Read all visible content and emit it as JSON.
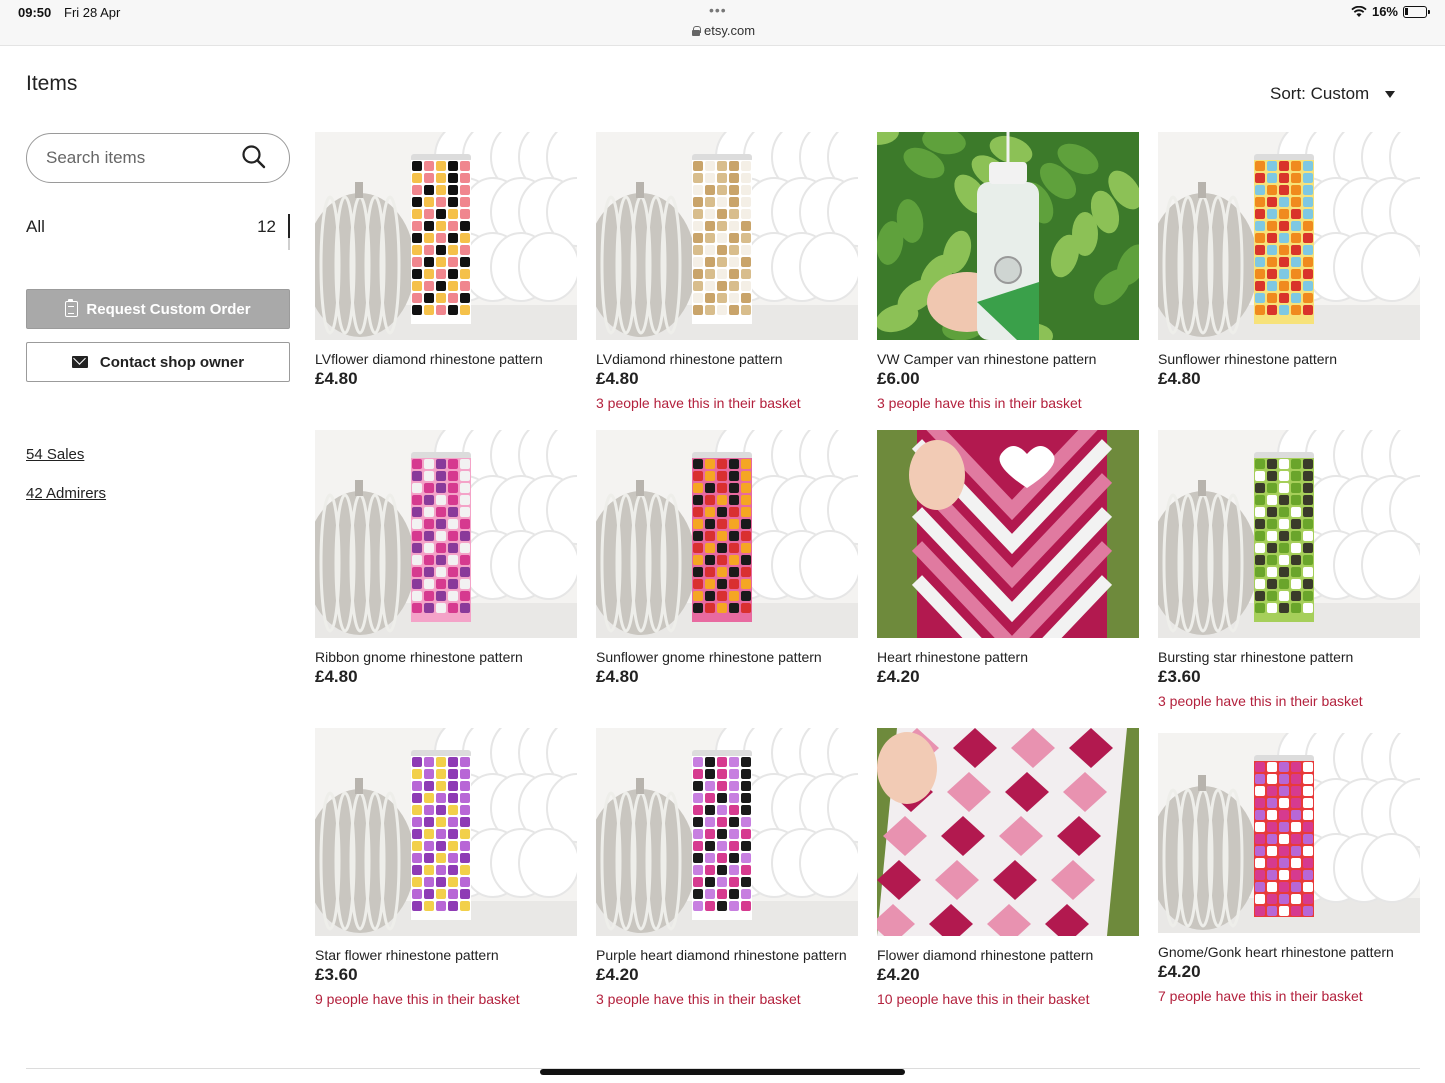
{
  "status_bar": {
    "time": "09:50",
    "date": "Fri 28 Apr",
    "dots": "•••",
    "url": "etsy.com",
    "battery": "16%"
  },
  "page": {
    "title": "Items",
    "sort_label": "Sort: Custom"
  },
  "sidebar": {
    "search_placeholder": "Search items",
    "all_label": "All",
    "all_count": "12",
    "request_button": "Request Custom Order",
    "contact_button": "Contact shop owner",
    "sales_link": "54 Sales",
    "admirers_link": "42 Admirers"
  },
  "colors": {
    "basket_text": "#b3213d",
    "request_button_bg": "#a9a9a9"
  },
  "items": [
    {
      "title": "LVflower diamond rhinestone pattern",
      "price": "£4.80",
      "basket": "",
      "scene": "studio",
      "tumbler_colors": [
        "#111111",
        "#f0868e",
        "#f5c14a",
        "#ffffff"
      ]
    },
    {
      "title": "LVdiamond rhinestone pattern",
      "price": "£4.80",
      "basket": "3 people have this in their basket",
      "scene": "studio",
      "tumbler_colors": [
        "#c9a46a",
        "#f4efe6",
        "#d8bd8c",
        "#ffffff"
      ]
    },
    {
      "title": "VW Camper van rhinestone pattern",
      "price": "£6.00",
      "basket": "3 people have this in their basket",
      "scene": "leaves",
      "tumbler_colors": [
        "#e8eeea",
        "#3aa04a",
        "#ffffff",
        "#9aa"
      ]
    },
    {
      "title": "Sunflower rhinestone pattern",
      "price": "£4.80",
      "basket": "",
      "scene": "studio",
      "tumbler_colors": [
        "#f08a1e",
        "#7ec8e3",
        "#d9342b",
        "#f7e27a"
      ]
    },
    {
      "title": "Ribbon gnome rhinestone pattern",
      "price": "£4.80",
      "basket": "",
      "scene": "studio",
      "tumbler_colors": [
        "#d63a8f",
        "#f2f2f2",
        "#8a3a9a",
        "#f4a3c8"
      ]
    },
    {
      "title": "Sunflower gnome rhinestone pattern",
      "price": "£4.80",
      "basket": "",
      "scene": "studio",
      "tumbler_colors": [
        "#1a1a1a",
        "#f5a623",
        "#d93030",
        "#e86aa0"
      ]
    },
    {
      "title": "Heart rhinestone pattern",
      "price": "£4.20",
      "basket": "",
      "scene": "heart",
      "tumbler_colors": [
        "#b2194f",
        "#f2f2f2",
        "#e07aa0",
        "#c8c8c8"
      ]
    },
    {
      "title": "Bursting star rhinestone pattern",
      "price": "£3.60",
      "basket": "3 people have this in their basket",
      "scene": "studio",
      "tumbler_colors": [
        "#6aa52b",
        "#3a3a2a",
        "#ffffff",
        "#a6cf5a"
      ]
    },
    {
      "title": "Star flower rhinestone pattern",
      "price": "£3.60",
      "basket": "9 people have this in their basket",
      "scene": "studio",
      "tumbler_colors": [
        "#8e3bb5",
        "#b867d6",
        "#f2d04a",
        "#ffffff"
      ]
    },
    {
      "title": "Purple heart diamond rhinestone pattern",
      "price": "£4.20",
      "basket": "3 people have this in their basket",
      "scene": "studio",
      "tumbler_colors": [
        "#c77fe0",
        "#1a1a1a",
        "#d63a8f",
        "#ffffff"
      ]
    },
    {
      "title": "Flower diamond rhinestone pattern",
      "price": "£4.20",
      "basket": "10 people have this in their basket",
      "scene": "flowergrass",
      "tumbler_colors": [
        "#b2194f",
        "#f2eef0",
        "#e892b0",
        "#c0ccd0"
      ]
    },
    {
      "title": "Gnome/Gonk heart rhinestone pattern",
      "price": "£4.20",
      "basket": "7 people have this in their basket",
      "scene": "studio",
      "tumbler_colors": [
        "#d63a8f",
        "#ffffff",
        "#b867d6",
        "#e83a3a"
      ]
    }
  ]
}
